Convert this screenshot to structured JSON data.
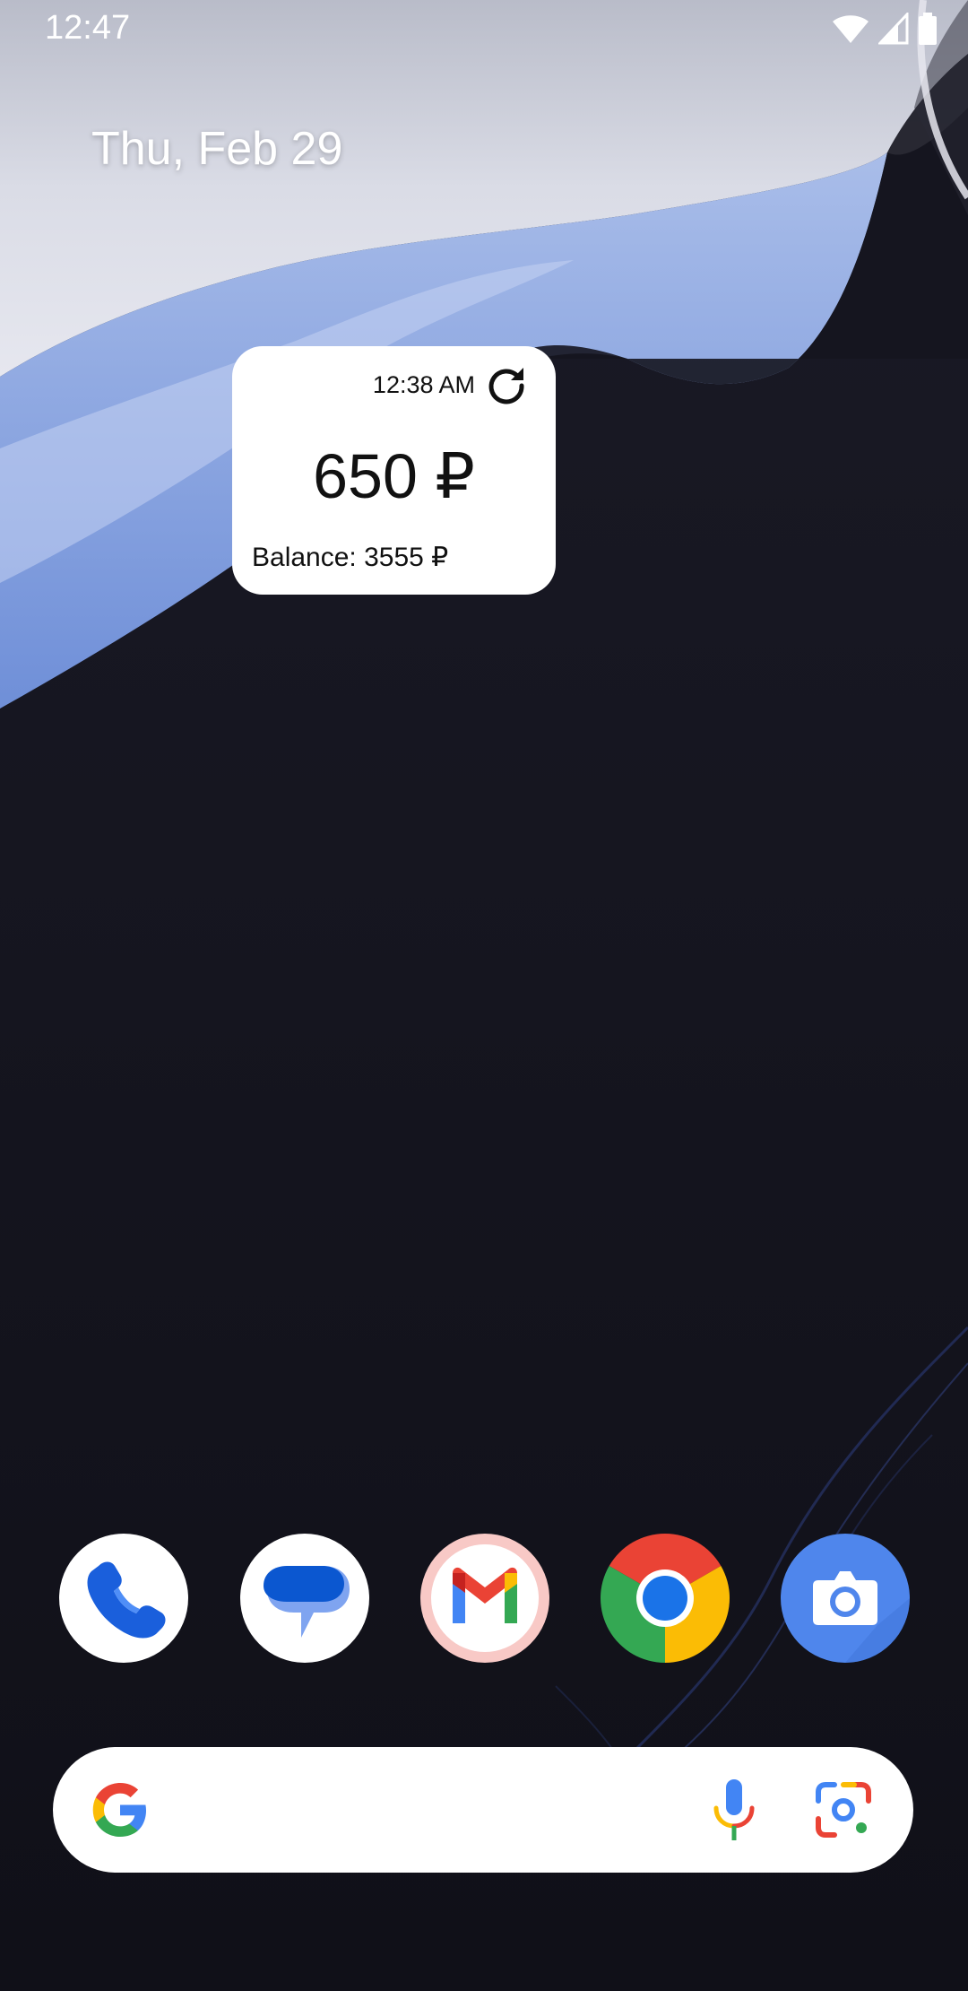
{
  "status_bar": {
    "time": "12:47",
    "icons": [
      "wifi-icon",
      "signal-icon",
      "battery-icon"
    ]
  },
  "home": {
    "date": "Thu, Feb 29"
  },
  "widget": {
    "updated_time": "12:38 AM",
    "amount": "650 ₽",
    "balance": "Balance: 3555 ₽",
    "refresh_icon": "refresh-icon"
  },
  "dock": {
    "apps": [
      {
        "name": "Phone",
        "icon": "phone-icon"
      },
      {
        "name": "Messages",
        "icon": "messages-icon"
      },
      {
        "name": "Gmail",
        "icon": "gmail-icon"
      },
      {
        "name": "Chrome",
        "icon": "chrome-icon"
      },
      {
        "name": "Camera",
        "icon": "camera-icon"
      }
    ]
  },
  "search": {
    "icons": [
      "google-g-icon",
      "microphone-icon",
      "lens-icon"
    ]
  },
  "colors": {
    "wallpaper_dark": "#12121c",
    "wallpaper_blue": "#7f9ee0",
    "google_blue": "#4285f4",
    "google_red": "#ea4335",
    "google_yellow": "#fbbc05",
    "google_green": "#34a853"
  }
}
